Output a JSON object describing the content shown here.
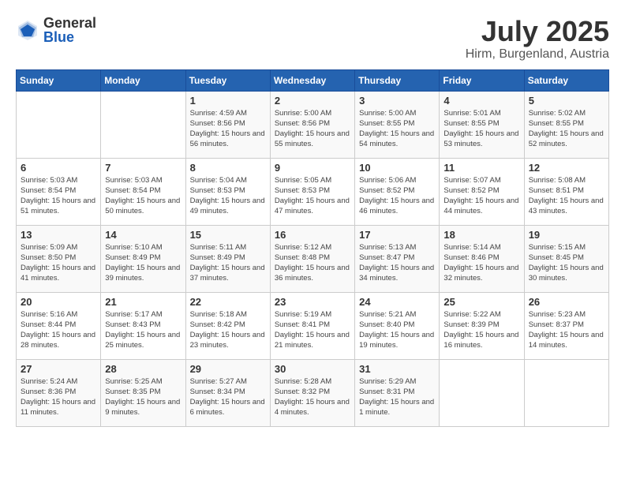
{
  "logo": {
    "general": "General",
    "blue": "Blue"
  },
  "header": {
    "month": "July 2025",
    "location": "Hirm, Burgenland, Austria"
  },
  "weekdays": [
    "Sunday",
    "Monday",
    "Tuesday",
    "Wednesday",
    "Thursday",
    "Friday",
    "Saturday"
  ],
  "weeks": [
    [
      {
        "day": "",
        "info": ""
      },
      {
        "day": "",
        "info": ""
      },
      {
        "day": "1",
        "sunrise": "Sunrise: 4:59 AM",
        "sunset": "Sunset: 8:56 PM",
        "daylight": "Daylight: 15 hours and 56 minutes."
      },
      {
        "day": "2",
        "sunrise": "Sunrise: 5:00 AM",
        "sunset": "Sunset: 8:56 PM",
        "daylight": "Daylight: 15 hours and 55 minutes."
      },
      {
        "day": "3",
        "sunrise": "Sunrise: 5:00 AM",
        "sunset": "Sunset: 8:55 PM",
        "daylight": "Daylight: 15 hours and 54 minutes."
      },
      {
        "day": "4",
        "sunrise": "Sunrise: 5:01 AM",
        "sunset": "Sunset: 8:55 PM",
        "daylight": "Daylight: 15 hours and 53 minutes."
      },
      {
        "day": "5",
        "sunrise": "Sunrise: 5:02 AM",
        "sunset": "Sunset: 8:55 PM",
        "daylight": "Daylight: 15 hours and 52 minutes."
      }
    ],
    [
      {
        "day": "6",
        "sunrise": "Sunrise: 5:03 AM",
        "sunset": "Sunset: 8:54 PM",
        "daylight": "Daylight: 15 hours and 51 minutes."
      },
      {
        "day": "7",
        "sunrise": "Sunrise: 5:03 AM",
        "sunset": "Sunset: 8:54 PM",
        "daylight": "Daylight: 15 hours and 50 minutes."
      },
      {
        "day": "8",
        "sunrise": "Sunrise: 5:04 AM",
        "sunset": "Sunset: 8:53 PM",
        "daylight": "Daylight: 15 hours and 49 minutes."
      },
      {
        "day": "9",
        "sunrise": "Sunrise: 5:05 AM",
        "sunset": "Sunset: 8:53 PM",
        "daylight": "Daylight: 15 hours and 47 minutes."
      },
      {
        "day": "10",
        "sunrise": "Sunrise: 5:06 AM",
        "sunset": "Sunset: 8:52 PM",
        "daylight": "Daylight: 15 hours and 46 minutes."
      },
      {
        "day": "11",
        "sunrise": "Sunrise: 5:07 AM",
        "sunset": "Sunset: 8:52 PM",
        "daylight": "Daylight: 15 hours and 44 minutes."
      },
      {
        "day": "12",
        "sunrise": "Sunrise: 5:08 AM",
        "sunset": "Sunset: 8:51 PM",
        "daylight": "Daylight: 15 hours and 43 minutes."
      }
    ],
    [
      {
        "day": "13",
        "sunrise": "Sunrise: 5:09 AM",
        "sunset": "Sunset: 8:50 PM",
        "daylight": "Daylight: 15 hours and 41 minutes."
      },
      {
        "day": "14",
        "sunrise": "Sunrise: 5:10 AM",
        "sunset": "Sunset: 8:49 PM",
        "daylight": "Daylight: 15 hours and 39 minutes."
      },
      {
        "day": "15",
        "sunrise": "Sunrise: 5:11 AM",
        "sunset": "Sunset: 8:49 PM",
        "daylight": "Daylight: 15 hours and 37 minutes."
      },
      {
        "day": "16",
        "sunrise": "Sunrise: 5:12 AM",
        "sunset": "Sunset: 8:48 PM",
        "daylight": "Daylight: 15 hours and 36 minutes."
      },
      {
        "day": "17",
        "sunrise": "Sunrise: 5:13 AM",
        "sunset": "Sunset: 8:47 PM",
        "daylight": "Daylight: 15 hours and 34 minutes."
      },
      {
        "day": "18",
        "sunrise": "Sunrise: 5:14 AM",
        "sunset": "Sunset: 8:46 PM",
        "daylight": "Daylight: 15 hours and 32 minutes."
      },
      {
        "day": "19",
        "sunrise": "Sunrise: 5:15 AM",
        "sunset": "Sunset: 8:45 PM",
        "daylight": "Daylight: 15 hours and 30 minutes."
      }
    ],
    [
      {
        "day": "20",
        "sunrise": "Sunrise: 5:16 AM",
        "sunset": "Sunset: 8:44 PM",
        "daylight": "Daylight: 15 hours and 28 minutes."
      },
      {
        "day": "21",
        "sunrise": "Sunrise: 5:17 AM",
        "sunset": "Sunset: 8:43 PM",
        "daylight": "Daylight: 15 hours and 25 minutes."
      },
      {
        "day": "22",
        "sunrise": "Sunrise: 5:18 AM",
        "sunset": "Sunset: 8:42 PM",
        "daylight": "Daylight: 15 hours and 23 minutes."
      },
      {
        "day": "23",
        "sunrise": "Sunrise: 5:19 AM",
        "sunset": "Sunset: 8:41 PM",
        "daylight": "Daylight: 15 hours and 21 minutes."
      },
      {
        "day": "24",
        "sunrise": "Sunrise: 5:21 AM",
        "sunset": "Sunset: 8:40 PM",
        "daylight": "Daylight: 15 hours and 19 minutes."
      },
      {
        "day": "25",
        "sunrise": "Sunrise: 5:22 AM",
        "sunset": "Sunset: 8:39 PM",
        "daylight": "Daylight: 15 hours and 16 minutes."
      },
      {
        "day": "26",
        "sunrise": "Sunrise: 5:23 AM",
        "sunset": "Sunset: 8:37 PM",
        "daylight": "Daylight: 15 hours and 14 minutes."
      }
    ],
    [
      {
        "day": "27",
        "sunrise": "Sunrise: 5:24 AM",
        "sunset": "Sunset: 8:36 PM",
        "daylight": "Daylight: 15 hours and 11 minutes."
      },
      {
        "day": "28",
        "sunrise": "Sunrise: 5:25 AM",
        "sunset": "Sunset: 8:35 PM",
        "daylight": "Daylight: 15 hours and 9 minutes."
      },
      {
        "day": "29",
        "sunrise": "Sunrise: 5:27 AM",
        "sunset": "Sunset: 8:34 PM",
        "daylight": "Daylight: 15 hours and 6 minutes."
      },
      {
        "day": "30",
        "sunrise": "Sunrise: 5:28 AM",
        "sunset": "Sunset: 8:32 PM",
        "daylight": "Daylight: 15 hours and 4 minutes."
      },
      {
        "day": "31",
        "sunrise": "Sunrise: 5:29 AM",
        "sunset": "Sunset: 8:31 PM",
        "daylight": "Daylight: 15 hours and 1 minute."
      },
      {
        "day": "",
        "info": ""
      },
      {
        "day": "",
        "info": ""
      }
    ]
  ]
}
